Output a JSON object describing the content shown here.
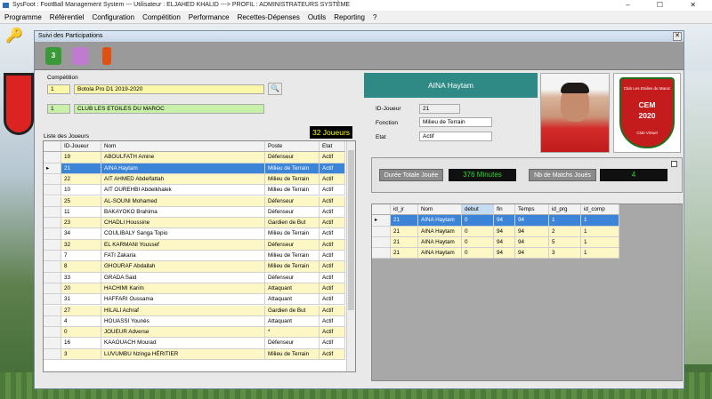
{
  "app": {
    "title": "SysFoot : FootBall Management System --- Utilisateur : ELJAHED KHALID ---> PROFIL : ADMINISTRATEURS SYSTÈME",
    "window_controls": "–  ☐  ✕"
  },
  "menu": [
    "Programme",
    "Référentiel",
    "Configuration",
    "Compétition",
    "Performance",
    "Recettes-Dépenses",
    "Outils",
    "Reporting",
    "?"
  ],
  "window": {
    "title": "Suivi des Participations",
    "close": "✕"
  },
  "toolbar": {
    "btn1": "3"
  },
  "competition": {
    "label": "Compétition",
    "id": "1",
    "name": "Botola Pro D1 2019-2020"
  },
  "club": {
    "id": "1",
    "name": "CLUB LES ETOILES DU MAROC"
  },
  "players": {
    "label": "Liste des Joueurs",
    "count_badge": "32 Joueurs",
    "columns": [
      "ID-Joueur",
      "Nom",
      "Poste",
      "Etat"
    ],
    "rows": [
      [
        "19",
        "ABOULFATH Amine",
        "Défenseur",
        "Actif"
      ],
      [
        "21",
        "AINA Haytam",
        "Milieu de Terrain",
        "Actif"
      ],
      [
        "22",
        "AIT AHMED Abdelfattah",
        "Milieu de Terrain",
        "Actif"
      ],
      [
        "10",
        "AIT OUREHBI Abdelkhalek",
        "Milieu de Terrain",
        "Actif"
      ],
      [
        "25",
        "AL-SOUNI Mohamed",
        "Défenseur",
        "Actif"
      ],
      [
        "11",
        "BAKAYOKO Brahima",
        "Défenseur",
        "Actif"
      ],
      [
        "23",
        "CHADLI Houssine",
        "Gardien de But",
        "Actif"
      ],
      [
        "34",
        "COULIBALY Sanga Topio",
        "Milieu de Terrain",
        "Actif"
      ],
      [
        "32",
        "EL KARMANI Youssef",
        "Défenseur",
        "Actif"
      ],
      [
        "7",
        "FATI Zakaria",
        "Milieu de Terrain",
        "Actif"
      ],
      [
        "8",
        "GHOURAF Abdallah",
        "Milieu de Terrain",
        "Actif"
      ],
      [
        "33",
        "GRADA Said",
        "Défenseur",
        "Actif"
      ],
      [
        "20",
        "HACHIMI Karim",
        "Attaquant",
        "Actif"
      ],
      [
        "31",
        "HAFFARI Oussama",
        "Attaquant",
        "Actif"
      ],
      [
        "27",
        "HILALI Achraf",
        "Gardien de But",
        "Actif"
      ],
      [
        "4",
        "HOUASSI Younès",
        "Attaquant",
        "Actif"
      ],
      [
        "0",
        "JOUEUR Adverse",
        "*",
        "Actif"
      ],
      [
        "16",
        "KAAOUACH Mourad",
        "Défenseur",
        "Actif"
      ],
      [
        "3",
        "LUVUMBU Nzinga HÉRITIER",
        "Milieu de Terrain",
        "Actif"
      ]
    ]
  },
  "player": {
    "name": "AINA Haytam",
    "id_label": "ID-Joueur",
    "id": "21",
    "fonction_label": "Fonction",
    "fonction": "Milieu de Terrain",
    "etat_label": "Etat",
    "etat": "Actif"
  },
  "logo": {
    "top": "Club Les Etoiles du Maroc",
    "abbr": "CEM",
    "year": "2020",
    "bottom": "Club Virtuel"
  },
  "stats": {
    "duree_label": "Durée Totale Jouée",
    "duree_value": "376 Minutes",
    "matchs_label": "Nb de Matchs Joués",
    "matchs_value": "4"
  },
  "matches": {
    "columns": [
      "id_jr",
      "Nom",
      "debut",
      "fin",
      "Temps",
      "id_prg",
      "id_comp"
    ],
    "rows": [
      [
        "21",
        "AINA Haytam",
        "0",
        "94",
        "94",
        "1",
        "1"
      ],
      [
        "21",
        "AINA Haytam",
        "0",
        "94",
        "94",
        "2",
        "1"
      ],
      [
        "21",
        "AINA Haytam",
        "0",
        "94",
        "94",
        "5",
        "1"
      ],
      [
        "21",
        "AINA Haytam",
        "0",
        "94",
        "94",
        "3",
        "1"
      ]
    ]
  },
  "colors": {
    "accent": "#2f8a86",
    "selection": "#3b84d8",
    "row_alt": "#fcf7c4"
  }
}
